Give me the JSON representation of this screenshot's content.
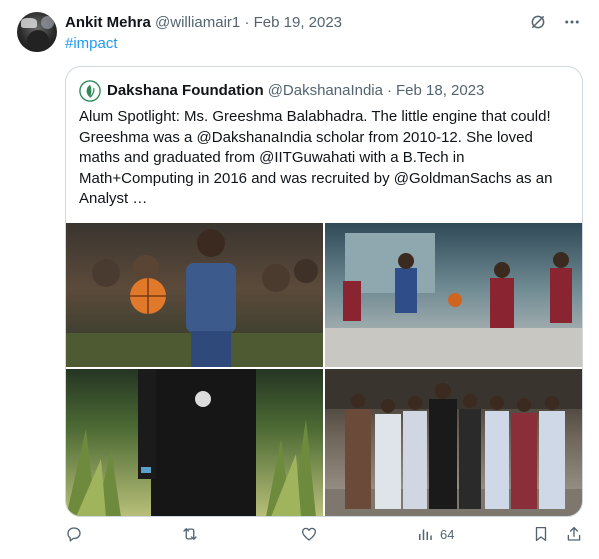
{
  "tweet": {
    "author_name": "Ankit Mehra",
    "author_handle": "@williamair1",
    "separator": "·",
    "date": "Feb 19, 2023",
    "hashtag": "#impact",
    "more_icon": "more-dots-icon",
    "grok_icon": "grok-icon"
  },
  "quote": {
    "author_name": "Dakshana Foundation",
    "author_handle": "@DakshanaIndia",
    "separator": "·",
    "date": "Feb 18, 2023",
    "text": "Alum Spotlight: Ms. Greeshma Balabhadra. The little engine that could! Greeshma was a @DakshanaIndia scholar from 2010-12. She loved maths and graduated from @IITGuwahati with a B.Tech in Math+Computing in 2016 and was recruited by @GoldmanSachs as an Analyst …",
    "media": [
      {
        "label": "photo-girl-dribbling-basketball"
      },
      {
        "label": "photo-basketball-game-court"
      },
      {
        "label": "photo-girl-in-black-tshirt-garden"
      },
      {
        "label": "photo-group-of-students"
      }
    ]
  },
  "actions": {
    "reply_icon": "reply-icon",
    "retweet_icon": "retweet-icon",
    "like_icon": "like-icon",
    "views_icon": "views-icon",
    "views_count": "64",
    "bookmark_icon": "bookmark-icon",
    "share_icon": "share-icon"
  },
  "colors": {
    "link": "#1d9bf0",
    "secondary_text": "#536471",
    "border": "#cfd9de",
    "brand_green": "#2e8b57"
  }
}
